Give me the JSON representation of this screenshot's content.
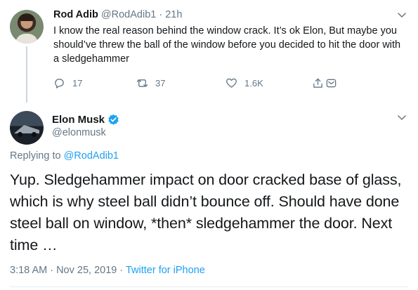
{
  "reply": {
    "name": "Rod Adib",
    "handle": "@RodAdib1",
    "separator": "·",
    "time": "21h",
    "text": "I know the real reason behind the window crack. It’s ok Elon, But maybe you should’ve threw the ball of the window before you decided to hit the door with a sledgehammer",
    "replies": "17",
    "retweets": "37",
    "likes": "1.6K"
  },
  "main": {
    "name": "Elon Musk",
    "handle": "@elonmusk",
    "replying_prefix": "Replying to",
    "replying_to": "@RodAdib1",
    "text": "Yup. Sledgehammer impact on door cracked base of glass, which is why steel ball didn’t bounce off. Should have done steel ball on window, *then* sledgehammer the door. Next time …",
    "timestamp": "3:18 AM · Nov 25, 2019 ·",
    "source": "Twitter for iPhone"
  },
  "colors": {
    "accent": "#1da1f2",
    "secondary_text": "#657786",
    "primary_text": "#14171a"
  },
  "icons": {
    "reply": "reply-icon",
    "retweet": "retweet-icon",
    "like": "heart-icon",
    "share": "share-icon",
    "dm": "dm-icon",
    "chevron": "chevron-down-icon",
    "verified": "verified-badge-icon"
  }
}
